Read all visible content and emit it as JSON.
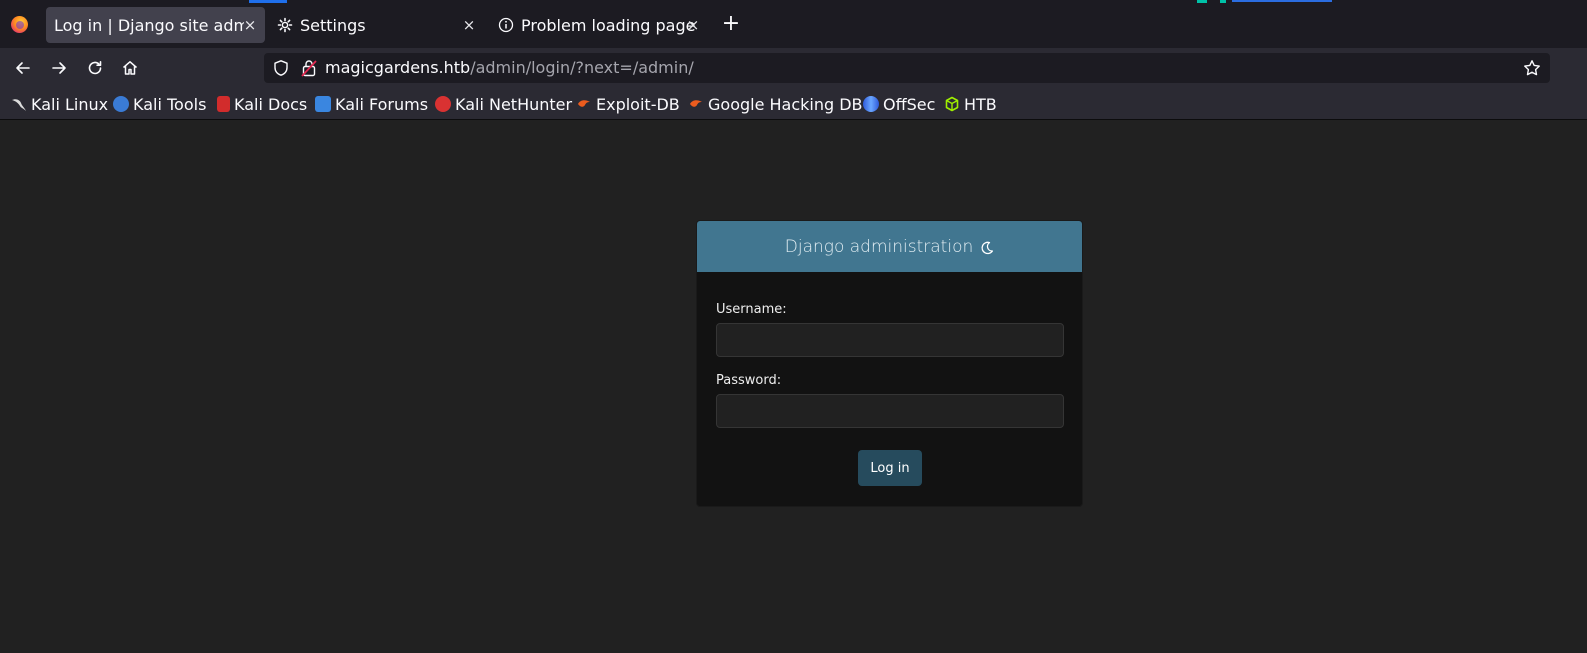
{
  "browser": {
    "tabs": [
      {
        "title": "Log in | Django site admin",
        "active": true,
        "close": "×"
      },
      {
        "title": "Settings",
        "active": false,
        "close": "×"
      },
      {
        "title": "Problem loading page",
        "active": false,
        "close": "×"
      }
    ],
    "new_tab": "+",
    "url": {
      "host": "magicgardens.htb",
      "path": "/admin/login/?next=/admin/"
    },
    "bookmarks": [
      {
        "label": "Kali Linux",
        "icon": "kali-dragon-icon",
        "color": "#cccccc"
      },
      {
        "label": "Kali Tools",
        "icon": "kali-tools-icon",
        "color": "#3a7bd5"
      },
      {
        "label": "Kali Docs",
        "icon": "kali-docs-icon",
        "color": "#d22c2c"
      },
      {
        "label": "Kali Forums",
        "icon": "kali-forums-icon",
        "color": "#3a86e0"
      },
      {
        "label": "Kali NetHunter",
        "icon": "kali-nethunter-icon",
        "color": "#d93232"
      },
      {
        "label": "Exploit-DB",
        "icon": "exploit-db-icon",
        "color": "#ec5c1e"
      },
      {
        "label": "Google Hacking DB",
        "icon": "ghdb-icon",
        "color": "#ec5c1e"
      },
      {
        "label": "OffSec",
        "icon": "offsec-icon",
        "color": "#4a7be0"
      },
      {
        "label": "HTB",
        "icon": "htb-cube-icon",
        "color": "#9fef00"
      }
    ]
  },
  "page": {
    "header_title": "Django administration",
    "username_label": "Username:",
    "username_value": "",
    "password_label": "Password:",
    "password_value": "",
    "submit_label": "Log in"
  },
  "colors": {
    "header_bg": "#417690",
    "card_bg": "#121212",
    "page_bg": "#212121",
    "button_bg": "#264b5d"
  }
}
